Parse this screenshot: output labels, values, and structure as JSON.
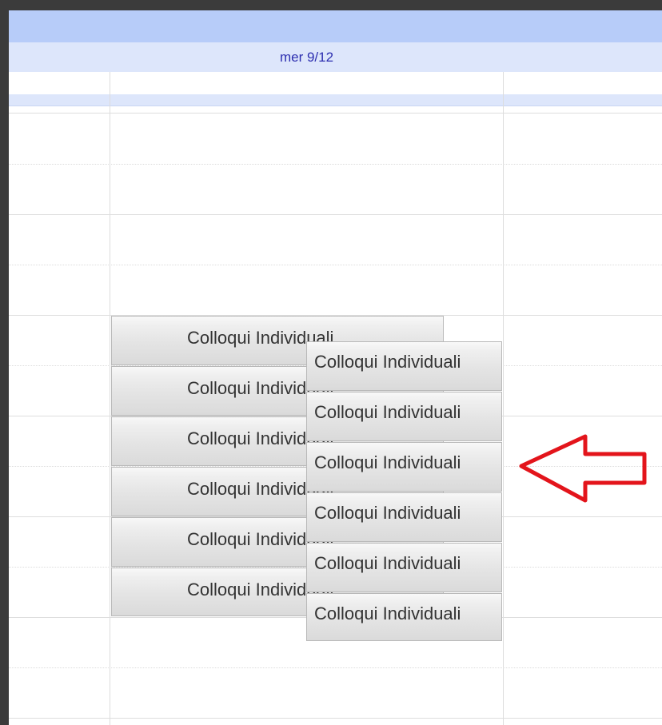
{
  "calendar": {
    "day_header": "mer 9/12",
    "events_column_a": [
      {
        "title": "Colloqui Individuali"
      },
      {
        "title": "Colloqui Individuali"
      },
      {
        "title": "Colloqui Individuali"
      },
      {
        "title": "Colloqui Individuali"
      },
      {
        "title": "Colloqui Individuali"
      },
      {
        "title": "Colloqui Individuali"
      }
    ],
    "events_column_b": [
      {
        "title": "Colloqui Individuali"
      },
      {
        "title": "Colloqui Individuali"
      },
      {
        "title": "Colloqui Individuali"
      },
      {
        "title": "Colloqui Individuali"
      },
      {
        "title": "Colloqui Individuali"
      },
      {
        "title": "Colloqui Individuali"
      }
    ],
    "highlighted_event_index": 2
  },
  "annotation": {
    "icon": "red-arrow-left-icon",
    "color": "#e3141b"
  },
  "colors": {
    "header_bar": "#b7ccf9",
    "day_header_bg": "#dde6fb",
    "day_header_text": "#2d2fb0",
    "event_bg": "#e4e4e4"
  }
}
